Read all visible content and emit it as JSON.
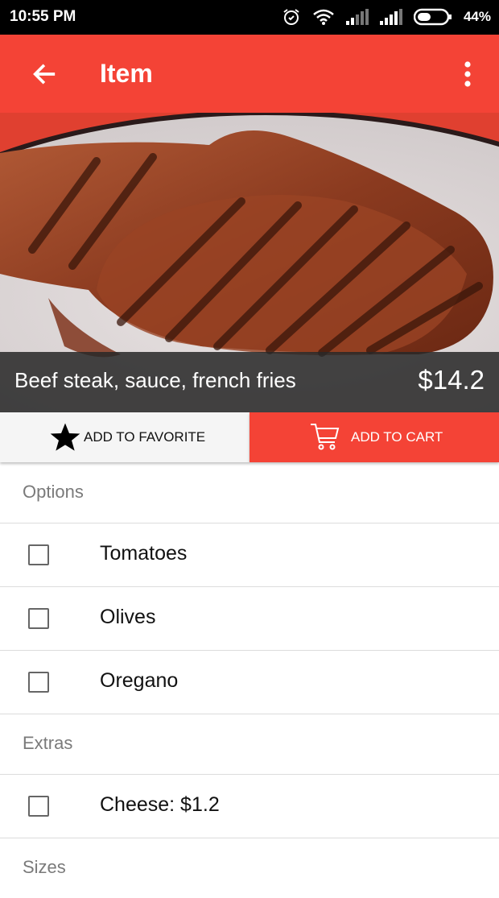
{
  "status_bar": {
    "time": "10:55 PM",
    "battery": "44%",
    "icons": [
      "alarm-icon",
      "wifi-icon",
      "signal-icon",
      "signal-icon",
      "battery-icon"
    ]
  },
  "app_bar": {
    "title": "Item",
    "back_icon": "arrow-left-icon",
    "menu_icon": "more-vert-icon",
    "color": "#f44336"
  },
  "item": {
    "name": "Beef steak, sauce, french fries",
    "price": "$14.2"
  },
  "actions": {
    "favorite_label": "ADD TO FAVORITE",
    "cart_label": "ADD TO CART"
  },
  "sections": {
    "options": {
      "title": "Options",
      "items": [
        {
          "label": "Tomatoes",
          "checked": false
        },
        {
          "label": "Olives",
          "checked": false
        },
        {
          "label": "Oregano",
          "checked": false
        }
      ]
    },
    "extras": {
      "title": "Extras",
      "items": [
        {
          "label": "Cheese: $1.2",
          "checked": false
        }
      ]
    },
    "sizes": {
      "title": "Sizes"
    }
  }
}
